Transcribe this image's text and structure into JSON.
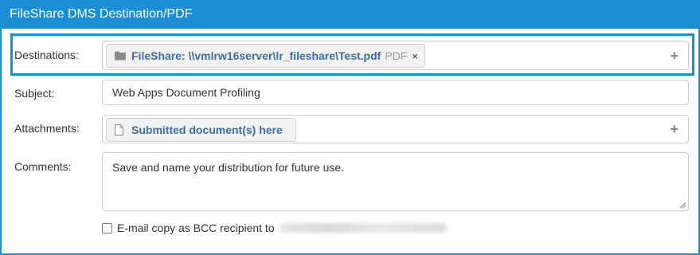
{
  "header": {
    "title": "FileShare DMS Destination/PDF"
  },
  "destinations": {
    "label": "Destinations:",
    "chip_name": "FileShare: \\\\vmlrw16server\\lr_fileshare\\Test.pdf",
    "chip_type": "PDF",
    "remove_glyph": "×",
    "add_glyph": "+"
  },
  "subject": {
    "label": "Subject:",
    "value": "Web Apps Document Profiling"
  },
  "attachments": {
    "label": "Attachments:",
    "chip_name": "Submitted document(s) here",
    "add_glyph": "+"
  },
  "comments": {
    "label": "Comments:",
    "value": "Save and name your distribution for future use."
  },
  "bcc": {
    "label": "E-mail copy as BCC recipient to",
    "checked": false
  },
  "colors": {
    "accent": "#1a8fd6",
    "link_text": "#3b6fa8"
  }
}
